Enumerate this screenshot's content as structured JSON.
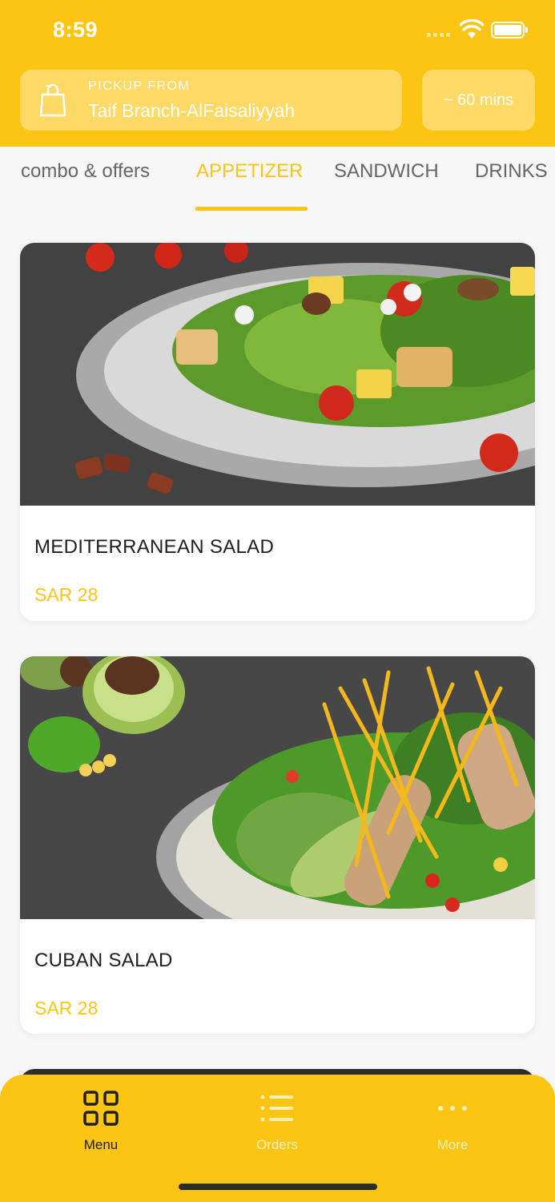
{
  "status_bar": {
    "time": "8:59"
  },
  "pickup": {
    "label": "PICKUP FROM",
    "branch": "Taif Branch-AlFaisaliyyah",
    "icon": "shopping-bag-icon"
  },
  "eta": {
    "label": "~ 60 mins"
  },
  "tabs": [
    {
      "label": "combo & offers",
      "active": false
    },
    {
      "label": "APPETIZER",
      "active": true
    },
    {
      "label": "SANDWICH",
      "active": false
    },
    {
      "label": "DRINKS",
      "active": false
    }
  ],
  "items": [
    {
      "name": "MEDITERRANEAN SALAD",
      "price": "SAR 28"
    },
    {
      "name": "CUBAN SALAD",
      "price": "SAR 28"
    }
  ],
  "bottom_nav": [
    {
      "label": "Menu",
      "icon": "grid-icon",
      "active": true
    },
    {
      "label": "Orders",
      "icon": "list-icon",
      "active": false
    },
    {
      "label": "More",
      "icon": "more-dots-icon",
      "active": false
    }
  ],
  "colors": {
    "brand_yellow": "#fdc513",
    "text_dark": "#1f1f1f",
    "tab_inactive": "#666666",
    "background": "#f7f7f7"
  }
}
